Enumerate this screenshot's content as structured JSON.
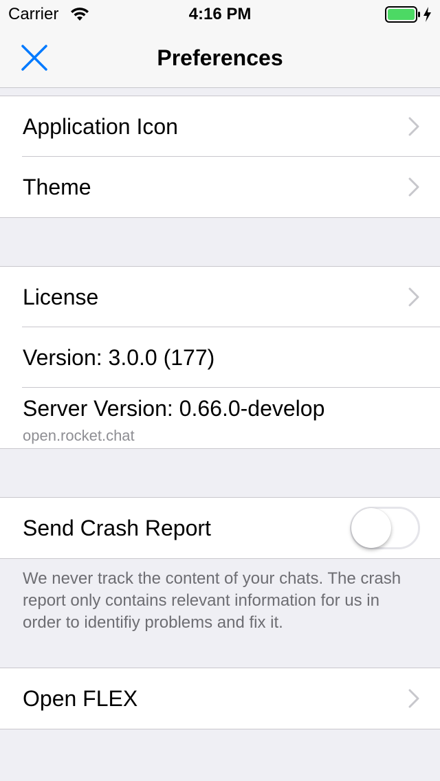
{
  "status_bar": {
    "carrier": "Carrier",
    "time": "4:16 PM",
    "battery_color": "#4cd964"
  },
  "nav": {
    "title": "Preferences",
    "accent_color": "#007aff",
    "close_icon": "close-icon"
  },
  "sections": {
    "appearance": {
      "application_icon": "Application Icon",
      "theme": "Theme"
    },
    "about": {
      "license": "License",
      "version": "Version: 3.0.0 (177)",
      "server_version": "Server Version: 0.66.0-develop",
      "server_host": "open.rocket.chat"
    },
    "crash": {
      "send_crash_report": "Send Crash Report",
      "toggle_on": false,
      "footer": "We never track the content of your chats. The crash report only contains relevant information for us in order to identifiy problems and fix it."
    },
    "debug": {
      "open_flex": "Open FLEX"
    }
  }
}
